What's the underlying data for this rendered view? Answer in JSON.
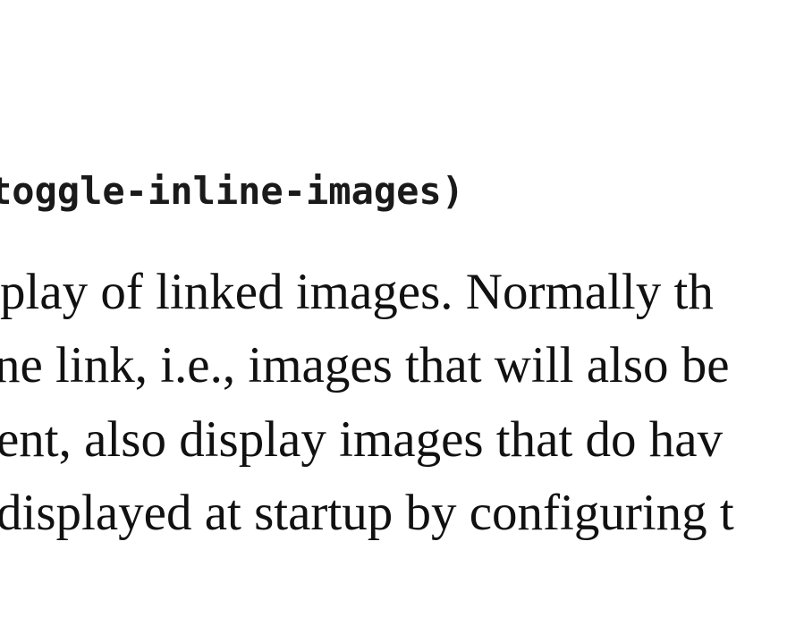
{
  "heading": "toggle-inline-images)",
  "body_lines": [
    "play of linked images. Normally th",
    "ne link, i.e., images that will also be",
    "ent, also display images that do hav",
    "displayed at startup by configuring t"
  ]
}
